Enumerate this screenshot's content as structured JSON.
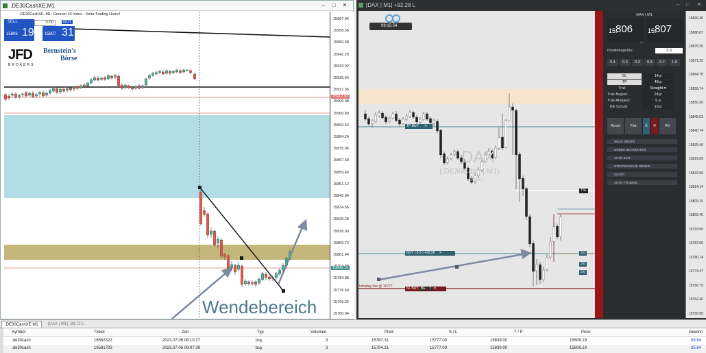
{
  "left_window": {
    "title": ".DE30CashXE,M1",
    "chart_info": ".DE30CashXE, M1:  German 40 Index - Xetra Trading Hours!",
    "sell_label": "SELL",
    "buy_label": "BUY",
    "lot": "3.00",
    "sell_price_small": "15806",
    "sell_price_big": "19",
    "buy_price_small": "15807",
    "buy_price_big": "31",
    "logo_text": "JFD",
    "logo_sub": "BROKERS",
    "partner_logo_line1": "Bernstein's",
    "partner_logo_line2": "Börse",
    "watermark_text": "Wendebereich",
    "price_ticks": [
      "15967.04",
      "15958.56",
      "15950.48",
      "15942.20",
      "15933.92",
      "15925.64",
      "15917.36",
      "15909.08",
      "15900.80",
      "15892.52",
      "15884.24",
      "15875.96",
      "15867.68",
      "15859.40",
      "15851.12",
      "15842.84",
      "15834.56",
      "15826.28",
      "15818.00",
      "15809.72",
      "15801.44",
      "15794.88",
      "15784.88",
      "15776.60",
      "15769.32",
      "15760.04"
    ],
    "current_price_tag": "15806.19",
    "line_price_tag": "15912.93"
  },
  "right_window": {
    "title": "[DAX | M1] +92.28 L",
    "time_badge": "09:15:54",
    "watermark_main": "DAX",
    "watermark_sub": "(.DE30Cash | M1)",
    "watermark_pl": "+92.28 L",
    "tp_label": "TP BUY",
    "buy_label": "BUY ( 6.0 ) +92.28",
    "sl_label": "SL BUY",
    "be_label": "BE",
    "t_label": "T",
    "intraday_label": "Intraday low @ 15777",
    "tsl_label": "TSL",
    "size_tag_1": "3.0",
    "size_tag_2": "3.0",
    "size_tag_3": "3.0",
    "price_ticks": [
      "15890.45",
      "15886.87",
      "15878.35",
      "15871.35",
      "15864.78",
      "15858.74",
      "15850.20",
      "15845.03",
      "15840.74",
      "15835.40",
      "15829.09",
      "15822.59",
      "15814.14",
      "15809.15",
      "15802.45",
      "15793.96",
      "15787.60",
      "15780.14",
      "15774.47",
      "15766.75",
      "15762.40",
      "15756.95"
    ]
  },
  "panel": {
    "header": "DAX | M1",
    "bid_small": "15.",
    "bid_big": "806",
    "ask_small": "15.",
    "ask_big": "807",
    "spread_label": "1.1",
    "position_label": "Positionsgröße",
    "position_value": "3.0",
    "lot_buttons": [
      "0.1",
      "0.2",
      "0.3",
      "0.5",
      "0.7",
      "1.0"
    ],
    "sl_label": "SL",
    "sl_value": "14 p",
    "tp_label": "TP",
    "tp_value": "48 p",
    "trail_label": "Trail",
    "trail_value": "Straight",
    "trail_begin_label": "Trail-Beginn",
    "trail_begin_value": "24 p",
    "trail_dist_label": "Trail-Abstand",
    "trail_dist_value": "5 p",
    "be_label": "BE Schutz",
    "be_value": "10 p",
    "reset_label": "Reset",
    "flat_label": "Flat",
    "x_label": "X",
    "rv_label": "RV",
    "menu": [
      "NEUE ORDER",
      "ORDER BEARBEITEN",
      "AUTO EXIT",
      "STRATEGISCHE ORDER",
      "CHART",
      "AUTO-TRADING"
    ]
  },
  "tabs": [
    ".DE30CashXE,M1",
    "[DAX | M1] -39.72 L"
  ],
  "table": {
    "headers": [
      "Symbol",
      "Ticket",
      "Zeit",
      "Typ",
      "Volumen",
      "Preis",
      "S / L",
      "T / P",
      "Preis",
      "Gewinn"
    ],
    "rows": [
      {
        "symbol": ".de30cash",
        "ticket": "16582322",
        "time": "2023.07.06 08:10:27",
        "type": "buy",
        "volume": "3",
        "price": "15787.31",
        "sl": "15777.00",
        "tp": "15839.00",
        "cur": "15806.19",
        "profit": "56.64"
      },
      {
        "symbol": ".de30cash",
        "ticket": "16581783",
        "time": "2023.07.06 08:07:39",
        "type": "buy",
        "volume": "3",
        "price": "15794.31",
        "sl": "15777.00",
        "tp": "15839.00",
        "cur": "15806.19",
        "profit": "35.64"
      }
    ]
  }
}
